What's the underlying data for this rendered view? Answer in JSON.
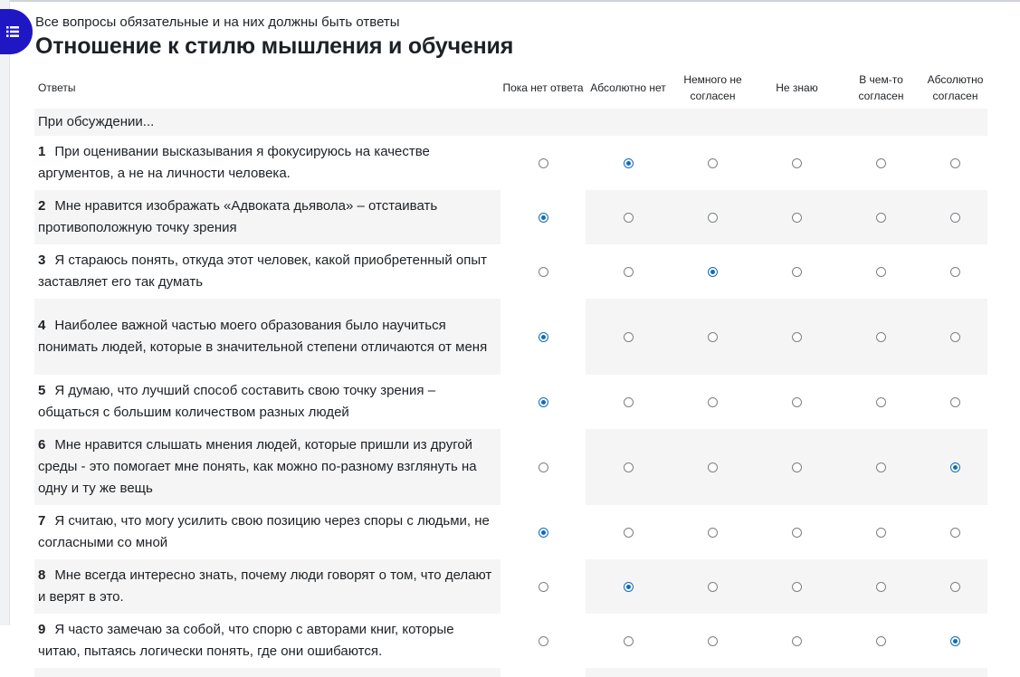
{
  "page": {
    "required_note": "Все вопросы обязательные и на них должны быть ответы",
    "title": "Отношение к стилю мышления и обучения"
  },
  "table": {
    "answers_header": "Ответы",
    "columns": [
      "Пока нет ответа",
      "Абсолютно нет",
      "Немного не согласен",
      "Не знаю",
      "В чем-то согласен",
      "Абсолютно согласен"
    ],
    "group_label": "При обсуждении...",
    "questions": [
      {
        "num": "1",
        "text": "При оценивании высказывания я фокусируюсь на качестве аргументов, а не на личности человека.",
        "selected": 1
      },
      {
        "num": "2",
        "text": "Мне нравится изображать «Адвоката дьявола» – отстаивать противоположную точку зрения",
        "selected": 0
      },
      {
        "num": "3",
        "text": "Я стараюсь понять, откуда этот человек, какой приобретенный опыт заставляет его так думать",
        "selected": 2
      },
      {
        "num": "4",
        "text": "Наиболее важной частью моего образования было научиться понимать людей, которые в значительной степени отличаются от меня",
        "selected": 0
      },
      {
        "num": "5",
        "text": "Я думаю, что лучший способ составить свою точку зрения – общаться с большим количеством разных людей",
        "selected": 0
      },
      {
        "num": "6",
        "text": "Мне нравится слышать мнения людей, которые пришли из другой среды - это помогает мне понять, как можно по-разному взглянуть на одну и ту же вещь",
        "selected": 5
      },
      {
        "num": "7",
        "text": "Я считаю, что могу усилить свою позицию через споры с людьми, не согласными со мной",
        "selected": 0
      },
      {
        "num": "8",
        "text": "Мне всегда интересно знать, почему люди говорят о том, что делают и верят в это.",
        "selected": 1
      },
      {
        "num": "9",
        "text": "Я часто замечаю за собой, что спорю с авторами книг, которые читаю, пытаясь логически понять, где они ошибаются.",
        "selected": 5
      }
    ]
  },
  "colors": {
    "accent": "#0f6cbf",
    "drawer_button": "#1f17c4",
    "row_shade": "#f5f5f5"
  },
  "icons": {
    "drawer": "list-icon"
  }
}
